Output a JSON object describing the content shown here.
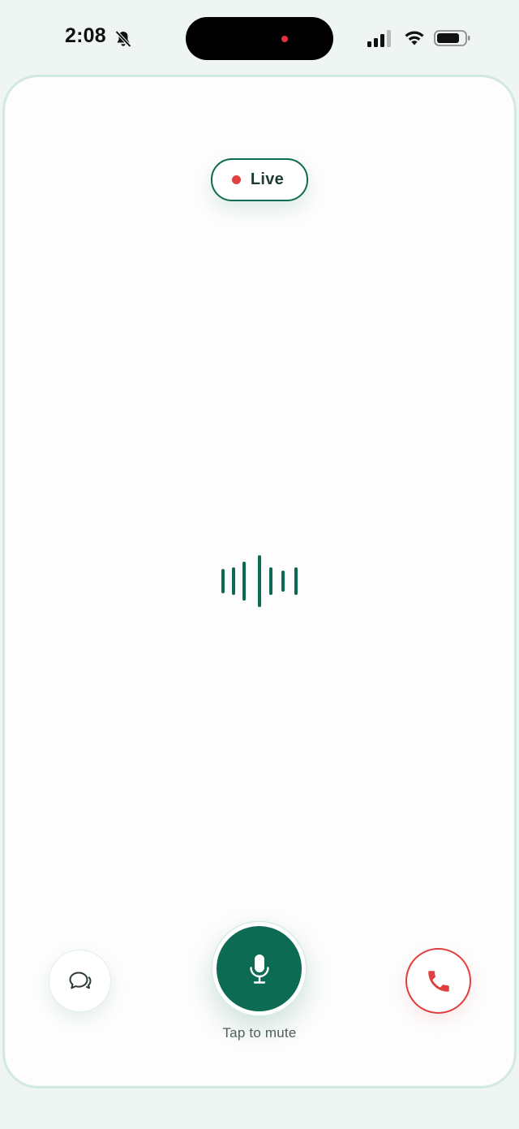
{
  "status_bar": {
    "time": "2:08",
    "icons": [
      "bell-slash-icon",
      "signal-icon",
      "wifi-icon",
      "battery-icon"
    ]
  },
  "call": {
    "live_label": "Live",
    "waveform_icon": "waveform-icon",
    "mute_hint": "Tap to mute",
    "buttons": {
      "chat_icon": "chat-bubbles-icon",
      "mic_icon": "microphone-icon",
      "end_call_icon": "phone-icon"
    }
  },
  "colors": {
    "accent": "#0c6b52",
    "live_dot": "#e04141",
    "end_call": "#df3f3f",
    "background": "#eef5f2",
    "card_border": "#d1e9e0"
  }
}
